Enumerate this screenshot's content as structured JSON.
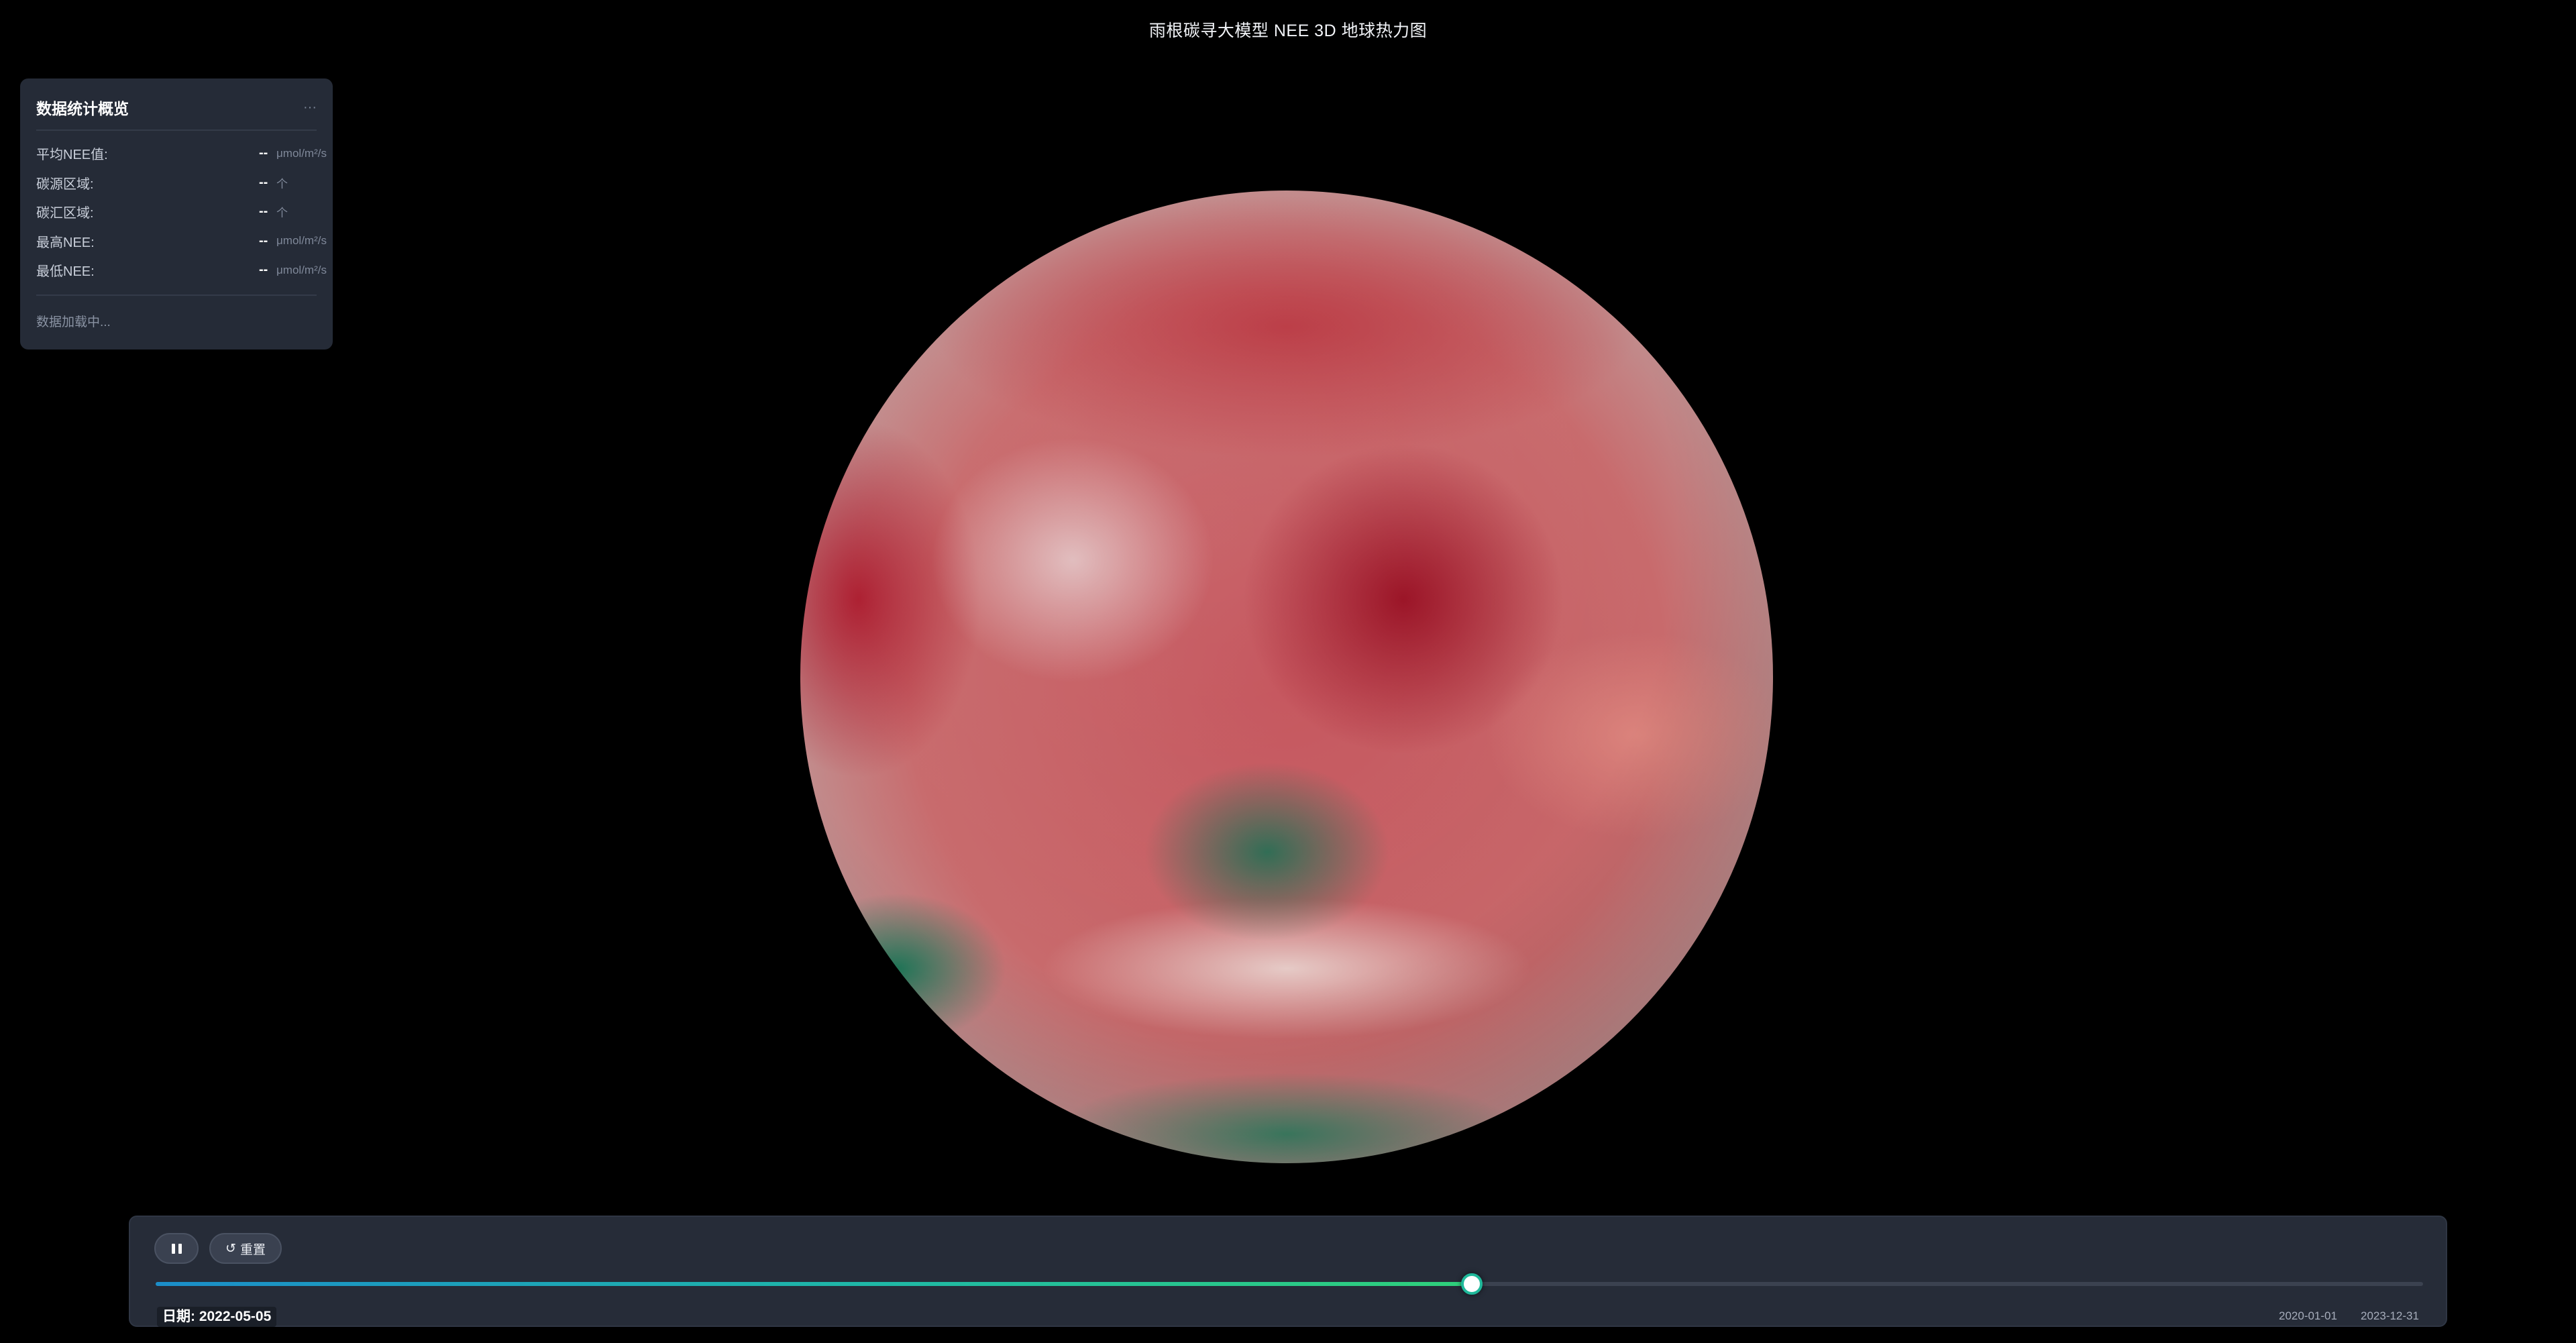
{
  "page": {
    "title": "雨根碳寻大模型 NEE 3D 地球热力图"
  },
  "stats_panel": {
    "title": "数据统计概览",
    "menu": "···",
    "rows": [
      {
        "label": "平均NEE值:",
        "value": "--",
        "unit": "μmol/m²/s"
      },
      {
        "label": "碳源区域:",
        "value": "--",
        "unit": "个"
      },
      {
        "label": "碳汇区域:",
        "value": "--",
        "unit": "个"
      },
      {
        "label": "最高NEE:",
        "value": "--",
        "unit": "μmol/m²/s"
      },
      {
        "label": "最低NEE:",
        "value": "--",
        "unit": "μmol/m²/s"
      }
    ],
    "status": "数据加载中..."
  },
  "globe": {
    "colors": {
      "source": "#9e1428",
      "neutral": "#e8e2e0",
      "sink": "#1a7a55"
    }
  },
  "timeline": {
    "pause_icon": "pause-icon",
    "reset_icon": "↺",
    "reset_label": "重置",
    "current_date": "日期: 2022-05-05",
    "start_date": "2020-01-01",
    "end_date": "2023-12-31",
    "progress": 0.5804,
    "accent": "#2fd07a"
  }
}
